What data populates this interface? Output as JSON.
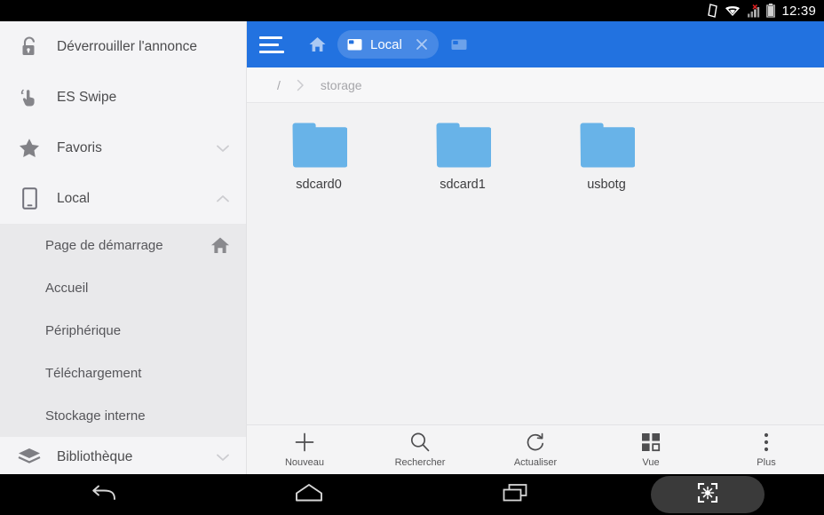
{
  "statusbar": {
    "time": "12:39",
    "icons": [
      "sim-card-icon",
      "wifi-icon",
      "cell-signal-no-service-icon",
      "battery-icon"
    ]
  },
  "sidebar": {
    "items": [
      {
        "label": "Déverrouiller l'annonce",
        "icon": "unlock-icon",
        "expander": ""
      },
      {
        "label": "ES Swipe",
        "icon": "swipe-hand-icon",
        "expander": ""
      },
      {
        "label": "Favoris",
        "icon": "star-icon",
        "expander": "chevron-down-icon"
      },
      {
        "label": "Local",
        "icon": "phone-icon",
        "expander": "chevron-up-icon"
      }
    ],
    "sub_items": [
      {
        "label": "Page de démarrage",
        "trailing_icon": "home-icon"
      },
      {
        "label": "Accueil",
        "trailing_icon": ""
      },
      {
        "label": "Périphérique",
        "trailing_icon": ""
      },
      {
        "label": "Téléchargement",
        "trailing_icon": ""
      },
      {
        "label": "Stockage interne",
        "trailing_icon": ""
      }
    ],
    "library_item": {
      "label": "Bibliothèque",
      "icon": "library-icon",
      "expander": "chevron-down-icon"
    }
  },
  "topbar": {
    "menu_icon": "hamburger-menu-icon",
    "home_icon": "home-icon",
    "tab": {
      "label": "Local",
      "window_icon": "window-icon",
      "close_icon": "close-icon"
    },
    "new_window_icon": "window-icon",
    "accent_color": "#2272e0"
  },
  "breadcrumb": {
    "segments": [
      "/",
      "storage"
    ],
    "separator_icon": "chevron-right-icon"
  },
  "files": [
    {
      "name": "sdcard0",
      "icon": "folder-icon"
    },
    {
      "name": "sdcard1",
      "icon": "folder-icon"
    },
    {
      "name": "usbotg",
      "icon": "folder-icon"
    }
  ],
  "folder_color": "#68b3e8",
  "bottombar": {
    "items": [
      {
        "label": "Nouveau",
        "icon": "plus-icon"
      },
      {
        "label": "Rechercher",
        "icon": "search-icon"
      },
      {
        "label": "Actualiser",
        "icon": "refresh-icon"
      },
      {
        "label": "Vue",
        "icon": "grid-view-icon"
      },
      {
        "label": "Plus",
        "icon": "more-vertical-icon"
      }
    ]
  },
  "navbar": {
    "buttons": [
      {
        "name": "back",
        "icon": "back-arrow-icon"
      },
      {
        "name": "home",
        "icon": "home-outline-icon"
      },
      {
        "name": "recents",
        "icon": "recents-icon"
      },
      {
        "name": "screenshot",
        "icon": "screenshot-capture-icon"
      }
    ]
  }
}
